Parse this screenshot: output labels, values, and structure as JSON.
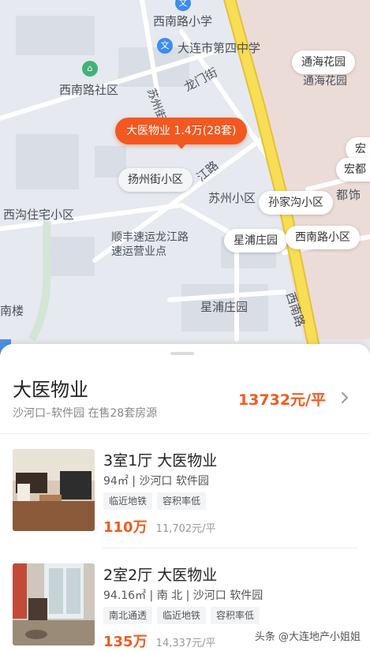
{
  "map": {
    "labels": {
      "xinan_school": "西南路小学",
      "dalian_school4": "大连市第四中学",
      "xinan_community": "西南路社区",
      "longmen_st": "龙门街",
      "suzhou_st": "苏州街",
      "tonghai_label": "通海花园",
      "xigou": "西沟住宅小区",
      "yangzhou_label": "扬州街小区",
      "jiang_label": "江路",
      "suzhou_xiaoqu": "苏州小区",
      "shunfeng": "顺丰速运龙江路速运营业点",
      "xingpu_label": "星浦庄园",
      "xinan_road": "西南路",
      "nan_lou": "南楼",
      "hong": "宏",
      "du": "都",
      "edge_rd": "饰"
    },
    "pins": {
      "school_icon": "文",
      "community_icon": "⌂"
    },
    "bubbles": {
      "active": "大医物业 1.4万(28套)",
      "tonghai": "通海花园",
      "yangzhou": "扬州街小区",
      "sunjiagou": "孙家沟小区",
      "xingpu": "星浦庄园",
      "xinan_xiaoqu": "西南路小区",
      "hong_edge": "宏",
      "hongdu_edge": "宏都"
    }
  },
  "estate": {
    "name": "大医物业",
    "subtitle": "沙河口–软件园 在售28套房源",
    "avg_price": "13732元/平"
  },
  "listings": [
    {
      "title": "3室1厅 大医物业",
      "desc": "94㎡ | 沙河口 软件园",
      "tags": [
        "临近地铁",
        "容积率低"
      ],
      "total": "110万",
      "unit_price": "11,702元/平"
    },
    {
      "title": "2室2厅 大医物业",
      "desc": "94.16㎡ | 南 北 | 沙河口 软件园",
      "tags": [
        "南北通透",
        "临近地铁",
        "容积率低"
      ],
      "total": "135万",
      "unit_price": "14,337元/平"
    }
  ],
  "watermark": "头条 @大连地产小姐姐",
  "colors": {
    "accent": "#f25a20",
    "road_main": "#f5d33f",
    "map_bg": "#e6e9ef"
  }
}
